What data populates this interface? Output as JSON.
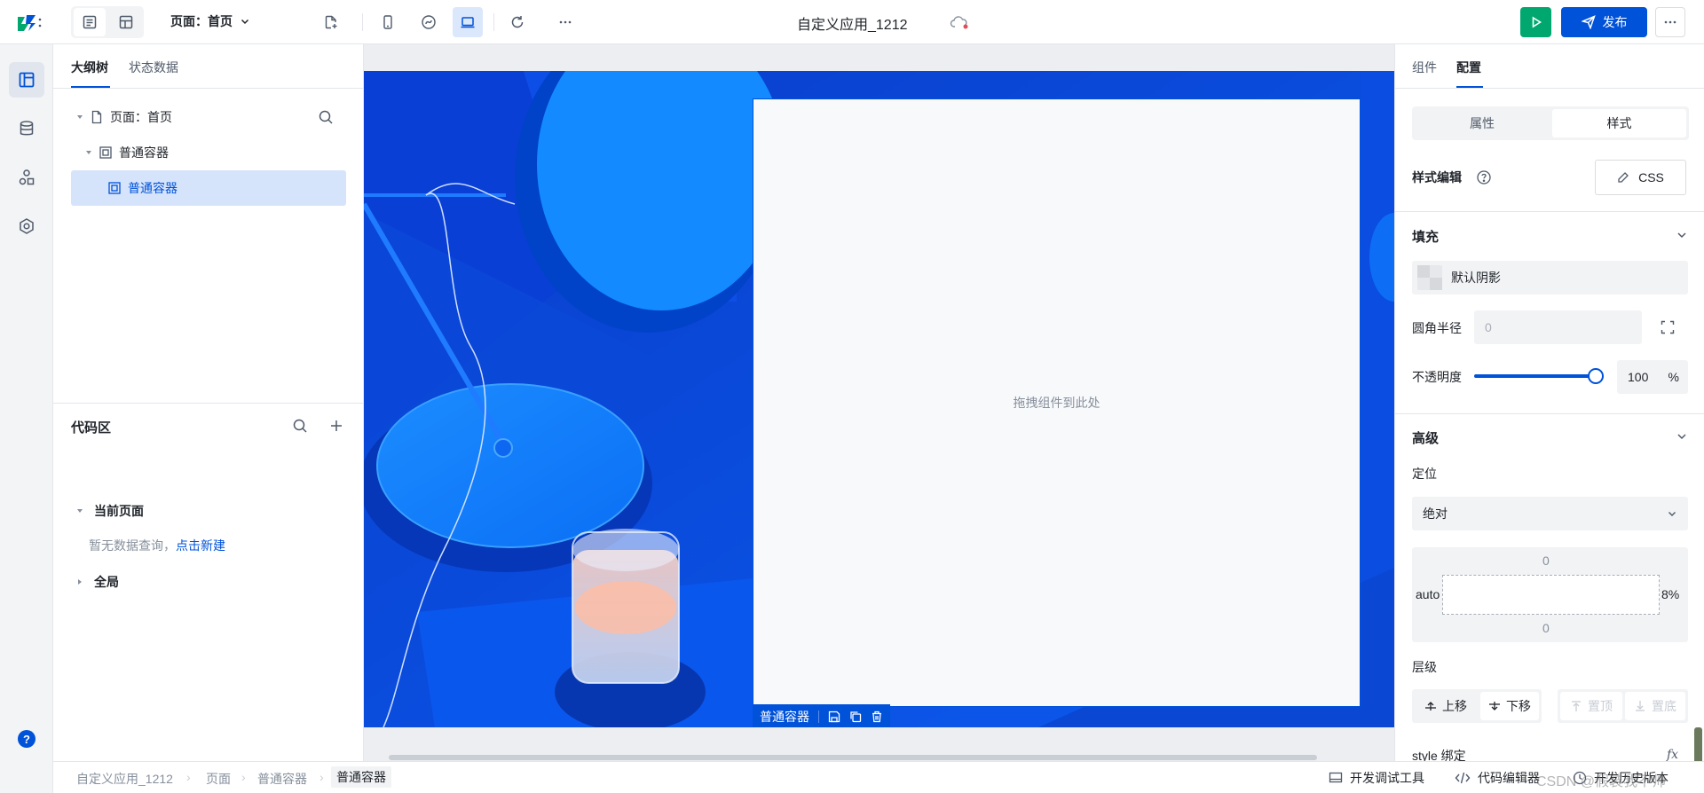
{
  "header": {
    "page_selector": "页面：首页",
    "app_title": "自定义应用_1212",
    "publish_label": "发布",
    "brand_color": "#0052d9",
    "run_color": "#00a870"
  },
  "left_rail": {
    "items": [
      "outline-icon",
      "database-icon",
      "components-icon",
      "settings-icon"
    ],
    "help_icon": "help-icon"
  },
  "left_panel": {
    "tabs": [
      "大纲树",
      "状态数据"
    ],
    "tree": {
      "page": "页面：首页",
      "container": "普通容器",
      "child": "普通容器"
    },
    "code_area": {
      "title": "代码区",
      "current_page": "当前页面",
      "empty_text": "暂无数据查询，",
      "create_link": "点击新建",
      "global": "全局"
    }
  },
  "canvas": {
    "drop_hint": "拖拽组件到此处",
    "selected_component": "普通容器"
  },
  "right_panel": {
    "tabs": [
      "组件",
      "配置"
    ],
    "segment": [
      "属性",
      "样式"
    ],
    "style_edit_label": "样式编辑",
    "css_button": "CSS",
    "fill_section": "填充",
    "fill_value": "默认阴影",
    "radius_label": "圆角半径",
    "radius_placeholder": "0",
    "opacity_label": "不透明度",
    "opacity_value": "100",
    "opacity_unit": "%",
    "opacity_fraction": 1.0,
    "advanced_section": "高级",
    "position_label": "定位",
    "position_value": "绝对",
    "box_top": "0",
    "box_left": "auto",
    "box_right": "8%",
    "box_bottom": "0",
    "layer_label": "层级",
    "move_up": "上移",
    "move_down": "下移",
    "to_top": "置顶",
    "to_bottom": "置底",
    "style_binding": "style 绑定"
  },
  "statusbar": {
    "breadcrumb": [
      "自定义应用_1212",
      "页面",
      "普通容器",
      "普通容器"
    ],
    "dev_tools": "开发调试工具",
    "code_editor": "代码编辑器",
    "watermark": "CSDN @假装我不帅",
    "history": "开发历史版本"
  }
}
